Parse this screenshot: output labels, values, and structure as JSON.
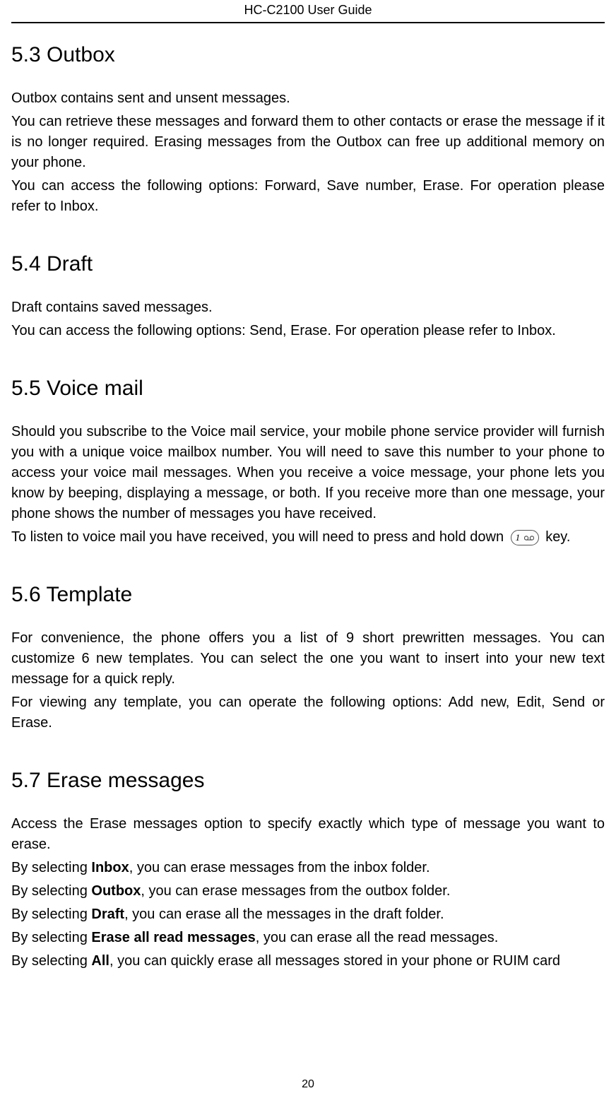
{
  "header": {
    "title": "HC-C2100 User Guide"
  },
  "footer": {
    "page_number": "20"
  },
  "sections": {
    "s53": {
      "heading": "5.3 Outbox",
      "p1": "Outbox contains sent and unsent messages.",
      "p2": "You can retrieve these messages and forward them to other contacts or erase the message if it is no longer required. Erasing messages from the Outbox can free up additional memory on your phone.",
      "p3": "You can access the following options: Forward, Save number, Erase. For operation please refer to Inbox."
    },
    "s54": {
      "heading": "5.4 Draft",
      "p1": "Draft contains saved messages.",
      "p2": "You can access the following options: Send, Erase. For operation please refer to Inbox."
    },
    "s55": {
      "heading": "5.5 Voice mail",
      "p1": "Should you subscribe to the Voice mail service, your mobile phone service provider will furnish you with a unique voice mailbox number. You will need to save this number to your phone to access your voice mail messages. When you receive a voice message, your phone lets you know by beeping, displaying a message, or both. If you receive more than one message, your phone shows the number of messages you have received.",
      "p2a": "To listen to voice mail you have received, you will need to press and hold down ",
      "p2b": " key."
    },
    "s56": {
      "heading": "5.6 Template",
      "p1": "For convenience, the phone offers you a list of 9 short prewritten messages. You can customize 6 new templates. You can select the one you want to insert into your new text message for a quick reply.",
      "p2": "For viewing any template, you can operate the following options: Add new, Edit, Send or Erase."
    },
    "s57": {
      "heading": "5.7 Erase messages",
      "p1": "Access the Erase messages option to specify exactly which type of message you want to erase.",
      "l1a": "By selecting ",
      "l1b": "Inbox",
      "l1c": ", you can erase messages from the inbox folder.",
      "l2a": "By selecting ",
      "l2b": "Outbox",
      "l2c": ", you can erase messages from the outbox folder.",
      "l3a": "By selecting ",
      "l3b": "Draft",
      "l3c": ", you can erase all the messages in the draft folder.",
      "l4a": "By selecting ",
      "l4b": "Erase all read messages",
      "l4c": ", you can erase all the read messages.",
      "l5a": "By selecting ",
      "l5b": "All",
      "l5c": ", you can quickly erase all messages stored in your phone or RUIM card"
    }
  },
  "icons": {
    "key1": "1"
  }
}
